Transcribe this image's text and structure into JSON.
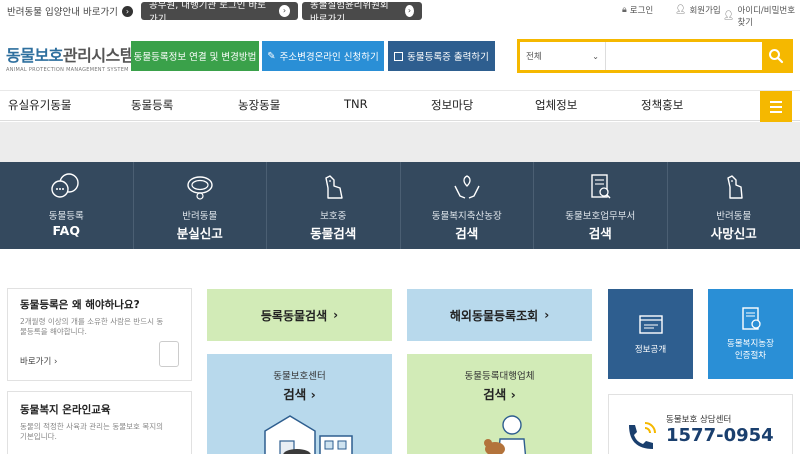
{
  "topbar": {
    "guide": "반려동물 입양안내 바로가기",
    "official_login": "공무원, 대행기관 로그인 바로가기",
    "ethics_committee": "동물실험윤리위원회 바로가기",
    "login": "로그인",
    "join": "회원가입",
    "find": "아이디/비밀번호 찾기"
  },
  "header": {
    "logo_main_a": "동물보호",
    "logo_main_b": "관리시스템",
    "logo_sub": "ANIMAL PROTECTION MANAGEMENT SYSTEM",
    "btn_link": "동물등록정보 연결 및 변경방법",
    "btn_online": "주소변경온라인 신청하기",
    "btn_print": "동물등록증 출력하기",
    "search_select": "전체",
    "search_placeholder": ""
  },
  "nav": {
    "items": [
      "유실유기동물",
      "동물등록",
      "농장동물",
      "TNR",
      "정보마당",
      "업체정보",
      "정책홍보"
    ]
  },
  "quick": [
    {
      "top": "동물등록",
      "bottom": "FAQ",
      "icon": "chat-bubbles-icon"
    },
    {
      "top": "반려동물",
      "bottom": "분실신고",
      "icon": "collar-icon"
    },
    {
      "top": "보호중",
      "bottom": "동물검색",
      "icon": "dog-icon"
    },
    {
      "top": "동물복지축산농장",
      "bottom": "검색",
      "icon": "hands-plant-icon"
    },
    {
      "top": "동물보호업무부서",
      "bottom": "검색",
      "icon": "document-search-icon"
    },
    {
      "top": "반려동물",
      "bottom": "사망신고",
      "icon": "sitting-dog-icon"
    }
  ],
  "cards": {
    "why_register_title": "동물등록은 왜 해야하나요?",
    "why_register_desc": "2개월령 이상의 개를 소유한 사람은 반드시 동물등록을 해야합니다.",
    "why_register_link": "바로가기",
    "education_title": "동물복지 온라인교육",
    "education_desc": "동물의 적정한 사육과 관리는 동물보호 복지의 기본입니다."
  },
  "bigbuttons": {
    "registered_search": "등록동물검색",
    "overseas_search": "해외동물등록조회",
    "center_top": "동물보호센터",
    "center_bottom": "검색",
    "agency_top": "동물등록대행업체",
    "agency_bottom": "검색"
  },
  "squares": {
    "info_disclosure": "정보공개",
    "welfare_farm_top": "동물복지농장",
    "welfare_farm_bottom": "인증절차"
  },
  "callcenter": {
    "label": "동물보호 상담센터",
    "number": "1577-0954"
  },
  "colors": {
    "accent_yellow": "#f5b800",
    "navy": "#34495e",
    "green_btn": "#3aa14a",
    "blue_btn": "#2a8fd6",
    "dark_blue_btn": "#2e5e8f"
  }
}
